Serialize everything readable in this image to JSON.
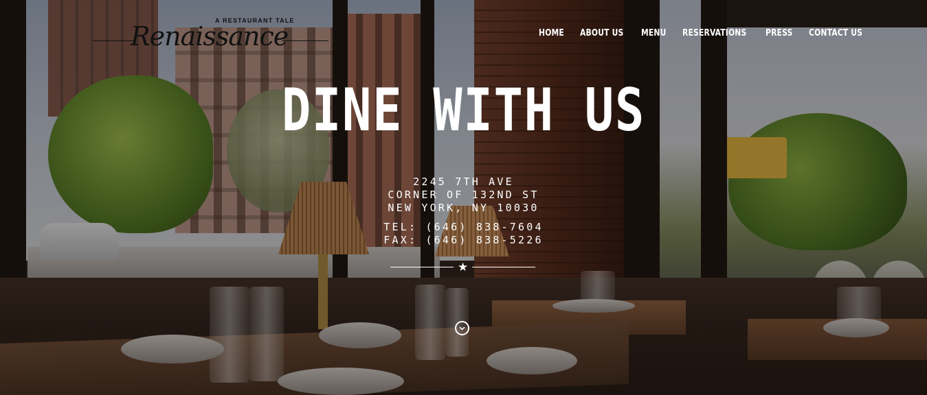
{
  "logo": {
    "tagline": "A RESTAURANT TALE",
    "name": "Renaissance"
  },
  "nav": {
    "items": [
      {
        "label": "HOME"
      },
      {
        "label": "ABOUT US"
      },
      {
        "label": "MENU"
      },
      {
        "label": "RESERVATIONS"
      },
      {
        "label": "PRESS"
      },
      {
        "label": "CONTACT US"
      }
    ]
  },
  "hero": {
    "title": "DINE WITH US",
    "address": {
      "line1": "2245 7TH AVE",
      "line2": "CORNER OF 132ND ST",
      "line3": "NEW YORK, NY 10030"
    },
    "contact": {
      "tel": "TEL: (646) 838-7604",
      "fax": "FAX: (646) 838-5226"
    },
    "divider_icon": "star-icon",
    "scroll_icon": "chevron-down-circle-icon"
  },
  "colors": {
    "text": "#ffffff",
    "logo": "#111111"
  }
}
